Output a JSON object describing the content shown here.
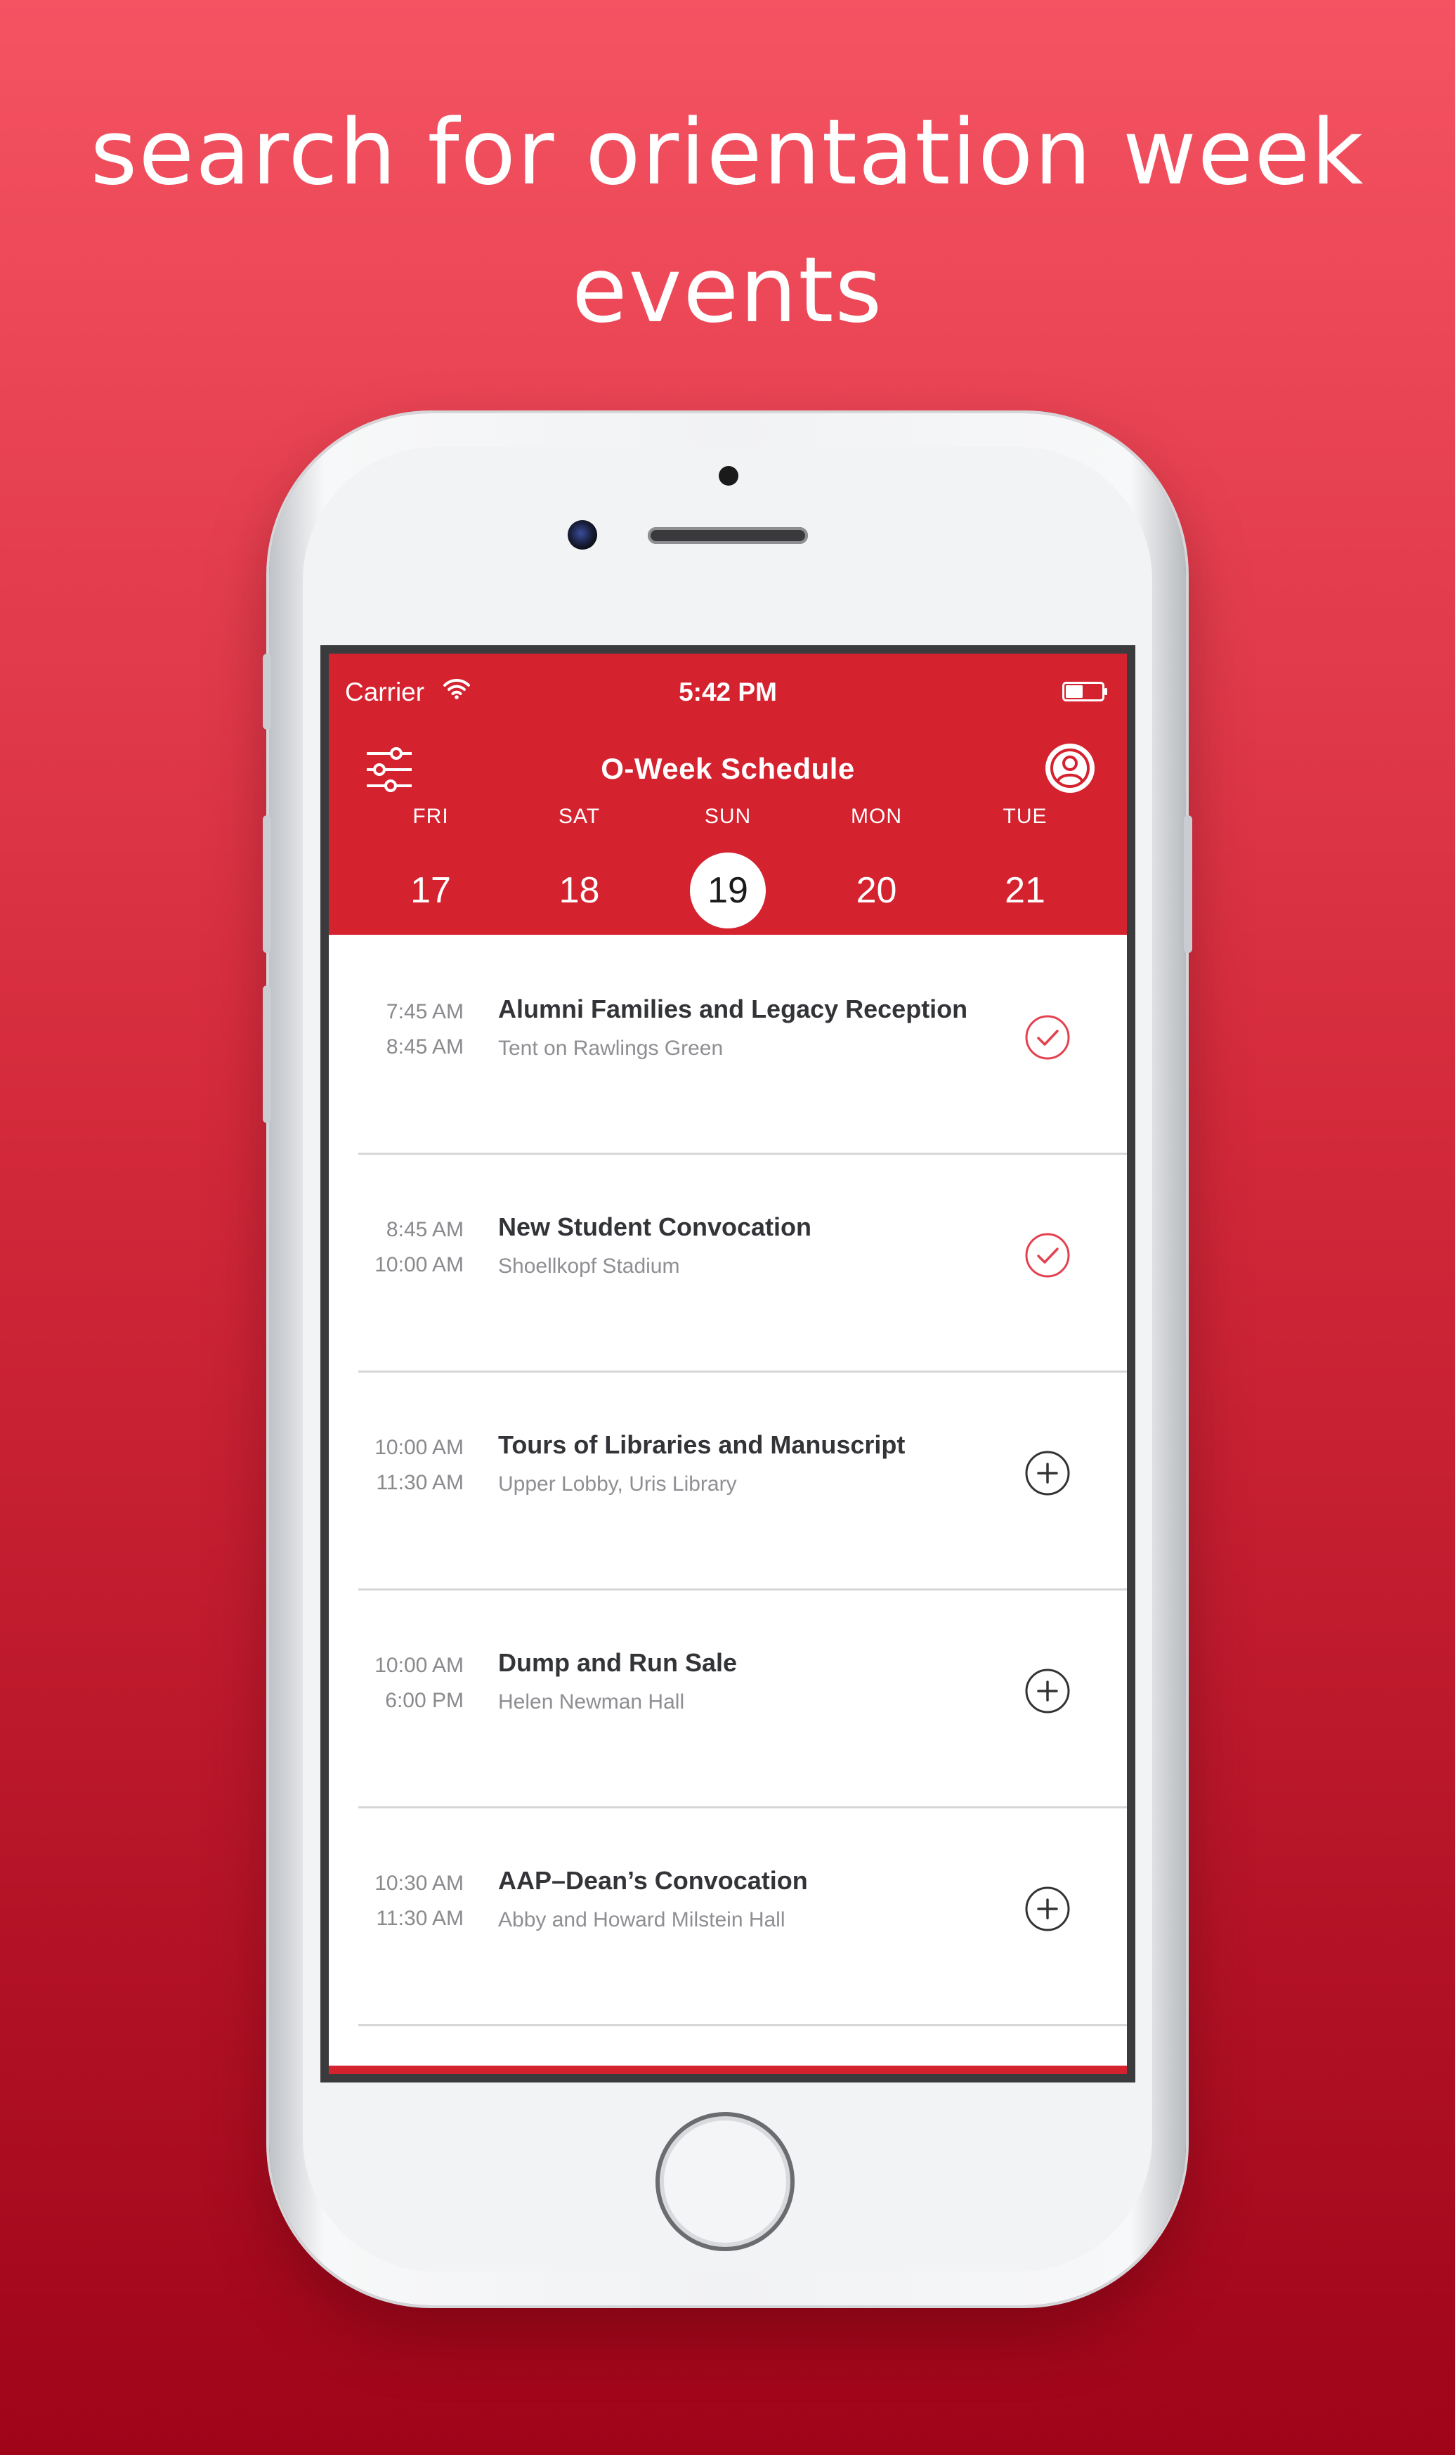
{
  "headline": {
    "line1": "search for orientation week",
    "line2": "events"
  },
  "status_bar": {
    "carrier": "Carrier",
    "time": "5:42 PM"
  },
  "nav": {
    "title": "O-Week Schedule"
  },
  "days": [
    {
      "name": "FRI",
      "num": "17",
      "selected": false
    },
    {
      "name": "SAT",
      "num": "18",
      "selected": false
    },
    {
      "name": "SUN",
      "num": "19",
      "selected": true
    },
    {
      "name": "MON",
      "num": "20",
      "selected": false
    },
    {
      "name": "TUE",
      "num": "21",
      "selected": false
    }
  ],
  "events": [
    {
      "start": "7:45 AM",
      "end": "8:45 AM",
      "title": "Alumni Families and Legacy Reception",
      "location": "Tent on Rawlings Green",
      "status": "added",
      "icon": "checkmark-circle-icon"
    },
    {
      "start": "8:45 AM",
      "end": "10:00 AM",
      "title": "New Student Convocation",
      "location": "Shoellkopf Stadium",
      "status": "added",
      "icon": "checkmark-circle-icon"
    },
    {
      "start": "10:00 AM",
      "end": "11:30 AM",
      "title": "Tours of Libraries and Manuscript",
      "location": "Upper Lobby, Uris Library",
      "status": "not-added",
      "icon": "plus-circle-icon"
    },
    {
      "start": "10:00 AM",
      "end": "6:00 PM",
      "title": "Dump and Run Sale",
      "location": "Helen Newman Hall",
      "status": "not-added",
      "icon": "plus-circle-icon"
    },
    {
      "start": "10:30 AM",
      "end": "11:30 AM",
      "title": "AAP–Dean’s Convocation",
      "location": "Abby and Howard Milstein Hall",
      "status": "not-added",
      "icon": "plus-circle-icon"
    }
  ],
  "colors": {
    "accent": "#d4222f",
    "added_icon": "#e4414f",
    "plus_icon": "#333333",
    "background_top": "#f55362",
    "background_bottom": "#9f0419"
  }
}
